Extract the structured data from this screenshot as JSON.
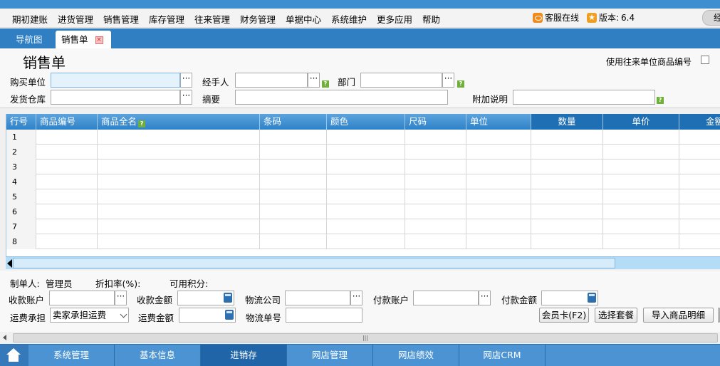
{
  "menu": [
    "期初建账",
    "进货管理",
    "销售管理",
    "库存管理",
    "往来管理",
    "财务管理",
    "单据中心",
    "系统维护",
    "更多应用",
    "帮助"
  ],
  "header_right": {
    "service_label": "客服在线",
    "version_label": "版本:",
    "version_value": "6.4",
    "pill_text": "经"
  },
  "tabs": [
    {
      "label": "导航图"
    },
    {
      "label": "销售单"
    }
  ],
  "page_title": "销售单",
  "use_partner_code_label": "使用往来单位商品编号",
  "form": {
    "buyer_label": "购买单位",
    "buyer_value": "",
    "handler_label": "经手人",
    "handler_value": "",
    "dept_label": "部门",
    "dept_value": "",
    "warehouse_label": "发货仓库",
    "warehouse_value": "",
    "summary_label": "摘要",
    "summary_value": "",
    "note_label": "附加说明",
    "note_value": ""
  },
  "grid": {
    "columns": [
      "行号",
      "商品编号",
      "商品全名",
      "条码",
      "颜色",
      "尺码",
      "单位",
      "数量",
      "单价",
      "金额"
    ],
    "row_numbers": [
      "1",
      "2",
      "3",
      "4",
      "5",
      "6",
      "7",
      "8"
    ]
  },
  "footer": {
    "maker_label": "制单人:",
    "maker_value": "管理员",
    "discount_label": "折扣率(%):",
    "points_label": "可用积分:",
    "receive_account_label": "收款账户",
    "receive_amount_label": "收款金额",
    "logistics_company_label": "物流公司",
    "pay_account_label": "付款账户",
    "pay_amount_label": "付款金额",
    "freight_label": "运费承担",
    "freight_value": "卖家承担运费",
    "freight_amount_label": "运费金额",
    "logistics_no_label": "物流单号",
    "member_card_button": "会员卡(F2)",
    "choose_package_button": "选择套餐",
    "import_detail_button": "导入商品明细"
  },
  "taskbar": [
    "系统管理",
    "基本信息",
    "进销存",
    "网店管理",
    "网店绩效",
    "网店CRM"
  ],
  "scroll_grip": "|||",
  "colors": {
    "accent": "#2f7fc2",
    "header_blue": "#4b93d3",
    "active_task": "#1f65a8"
  }
}
